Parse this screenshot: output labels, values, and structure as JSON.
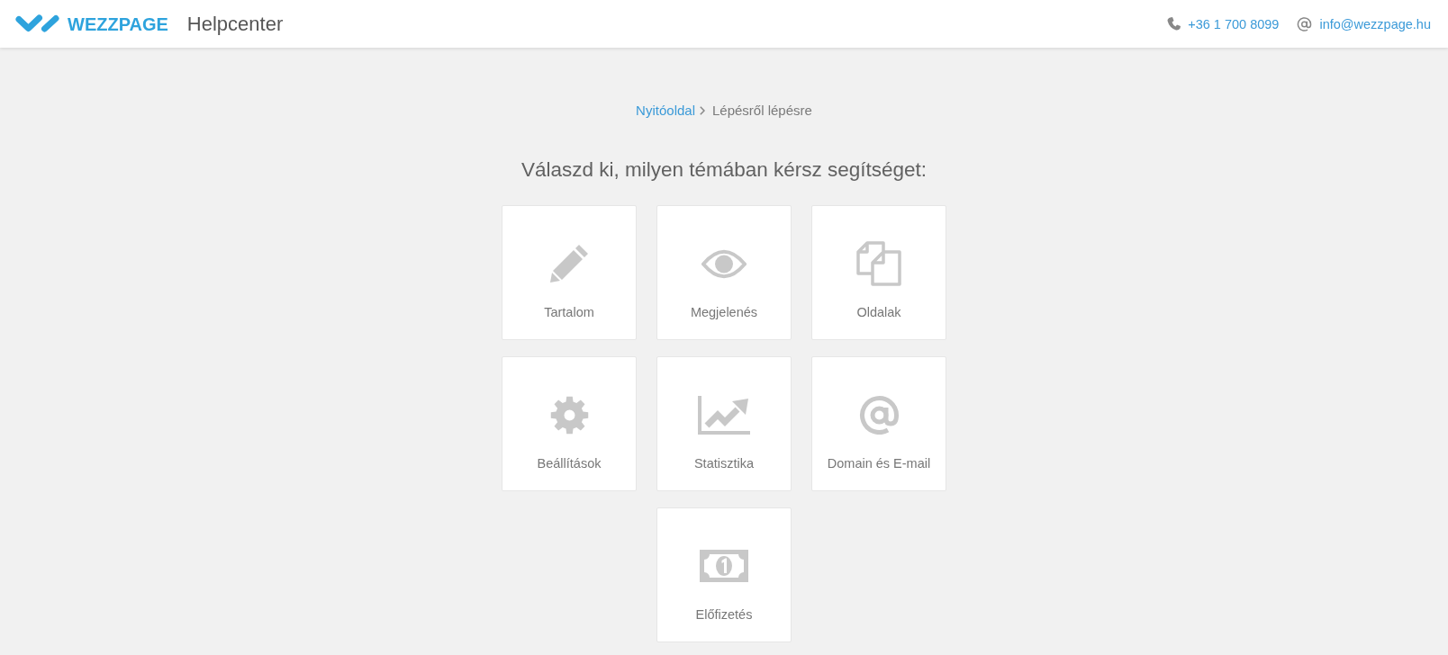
{
  "header": {
    "brand": "WEZZPAGE",
    "section": "Helpcenter",
    "phone": "+36 1 700 8099",
    "email": "info@wezzpage.hu"
  },
  "breadcrumb": [
    {
      "label": "Nyitóoldal",
      "current": false
    },
    {
      "label": "Lépésről lépésre",
      "current": true
    }
  ],
  "heading": "Válaszd ki, milyen témában kérsz segítséget:",
  "topics": [
    {
      "label": "Tartalom"
    },
    {
      "label": "Megjelenés"
    },
    {
      "label": "Oldalak"
    },
    {
      "label": "Beállítások"
    },
    {
      "label": "Statisztika"
    },
    {
      "label": "Domain és E-mail"
    },
    {
      "label": "Előfizetés"
    }
  ]
}
